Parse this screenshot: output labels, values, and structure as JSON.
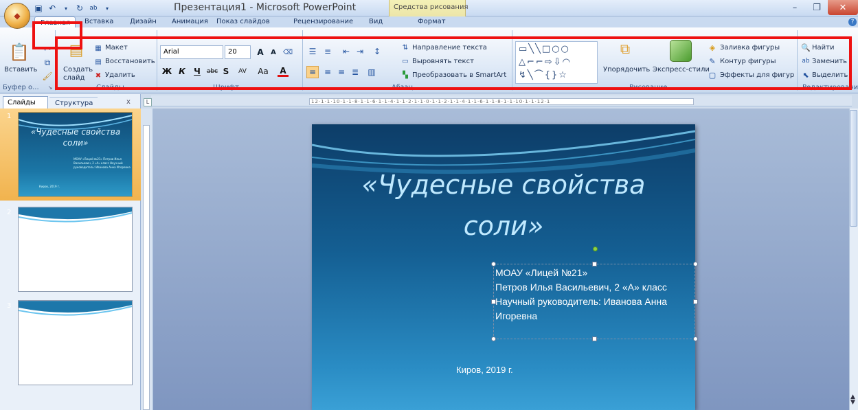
{
  "window": {
    "title": "Презентация1 - Microsoft PowerPoint",
    "context_tab_group": "Средства рисования"
  },
  "tabs": [
    {
      "label": "Главная"
    },
    {
      "label": "Вставка"
    },
    {
      "label": "Дизайн"
    },
    {
      "label": "Анимация"
    },
    {
      "label": "Показ слайдов"
    },
    {
      "label": "Рецензирование"
    },
    {
      "label": "Вид"
    },
    {
      "label": "Формат"
    }
  ],
  "ribbon": {
    "clipboard": {
      "paste": "Вставить",
      "group": "Буфер о..."
    },
    "slides": {
      "create_line1": "Создать",
      "create_line2": "слайд",
      "layout": "Макет",
      "reset": "Восстановить",
      "delete": "Удалить",
      "group": "Слайды"
    },
    "font": {
      "name": "Arial",
      "size": "20",
      "group": "Шрифт",
      "bold": "Ж",
      "italic": "К",
      "underline": "Ч",
      "strike": "abc",
      "shadow": "S",
      "spacing": "AV",
      "case": "Aa",
      "color": "A"
    },
    "paragraph": {
      "direction": "Направление текста",
      "align_text": "Выровнять текст",
      "smartart": "Преобразовать в SmartArt",
      "group": "Абзац"
    },
    "drawing": {
      "arrange": "Упорядочить",
      "quick_styles": "Экспресс-стили",
      "fill": "Заливка фигуры",
      "outline": "Контур фигуры",
      "effects": "Эффекты для фигур",
      "group": "Рисование"
    },
    "editing": {
      "find": "Найти",
      "replace": "Заменить",
      "select": "Выделить",
      "group": "Редактирование"
    }
  },
  "pane": {
    "tab_slides": "Слайды",
    "tab_outline": "Структура",
    "close": "x",
    "thumbs": [
      {
        "num": "1"
      },
      {
        "num": "2"
      },
      {
        "num": "3"
      }
    ]
  },
  "slide": {
    "title_line1": "«Чудесные свойства",
    "title_line2": "соли»",
    "body": [
      "МОАУ «Лицей №21»",
      "Петров Илья Васильевич, 2 «А» класс",
      "Научный руководитель: Иванова Анна",
      "Игоревна"
    ],
    "footer": "Киров, 2019 г."
  },
  "ruler": {
    "top_ticks": "12·1·1·10·1·1·8·1·1·6·1·1·4·1·1·2·1·1·0·1·1·2·1·1·4·1·1·6·1·1·8·1·1·10·1·1·12·1"
  },
  "thumb_text": {
    "small": "МОАУ «Лицей №21» Петров Илья Васильевич, 2 «А» класс Научный руководитель: Иванова Анна Игоревна",
    "foot": "Киров, 2019 г."
  },
  "colors": {
    "highlight_box": "#ee1111",
    "slide_gradient_top": "#0d3d68",
    "slide_gradient_bottom": "#3aa0d6",
    "selected_thumb": "#f1b34e"
  }
}
